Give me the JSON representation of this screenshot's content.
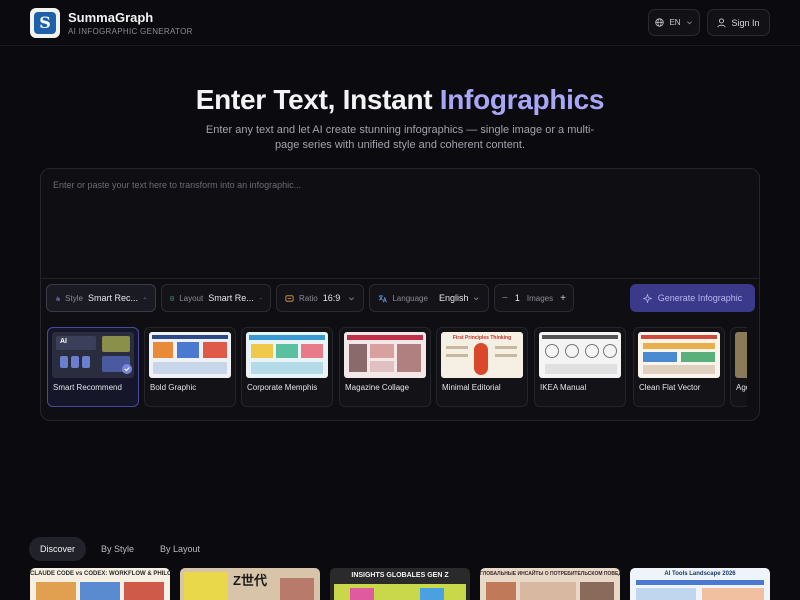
{
  "header": {
    "brand_name": "SummaGraph",
    "brand_sub": "AI INFOGRAPHIC GENERATOR",
    "lang_label": "EN",
    "signin_label": "Sign In"
  },
  "hero": {
    "title_main": "Enter Text, Instant ",
    "title_accent": "Infographics",
    "subtitle": "Enter any text and let AI create stunning infographics — single image or a multi-page series with unified style and coherent content."
  },
  "input": {
    "placeholder": "Enter or paste your text here to transform into an infographic..."
  },
  "controls": {
    "style_label": "Style",
    "style_value": "Smart Rec...",
    "layout_label": "Layout",
    "layout_value": "Smart Re...",
    "ratio_label": "Ratio",
    "ratio_value": "16:9",
    "language_label": "Language",
    "language_value": "English",
    "images_minus": "−",
    "images_count": "1",
    "images_label": "Images",
    "images_plus": "+",
    "generate_label": "Generate Infographic"
  },
  "styles": [
    {
      "label": "Smart Recommend",
      "thumb_badge": "AI"
    },
    {
      "label": "Bold Graphic"
    },
    {
      "label": "Corporate Memphis"
    },
    {
      "label": "Magazine Collage"
    },
    {
      "label": "Minimal Editorial",
      "thumb_title": "First Principles Thinking"
    },
    {
      "label": "IKEA Manual"
    },
    {
      "label": "Clean Flat Vector"
    },
    {
      "label": "Age"
    }
  ],
  "tabs": [
    {
      "label": "Discover",
      "active": true
    },
    {
      "label": "By Style"
    },
    {
      "label": "By Layout"
    }
  ],
  "gallery": [
    {
      "title": "CLAUDE CODE vs CODEX: WORKFLOW & PHILOSOPHY"
    },
    {
      "title": "Z世代"
    },
    {
      "title": "INSIGHTS GLOBALES GEN Z"
    },
    {
      "title": "ГЛОБАЛЬНЫЕ ИНСАЙТЫ О ПОТРЕБИТЕЛЬСКОМ ПОВЕДЕНИИ GEN Z"
    },
    {
      "title": "AI Tools Landscape 2026"
    }
  ],
  "colors": {
    "background": "#0b0b0f",
    "accent": "#a9a6f5",
    "generate_bg": "#3b3a8a"
  }
}
